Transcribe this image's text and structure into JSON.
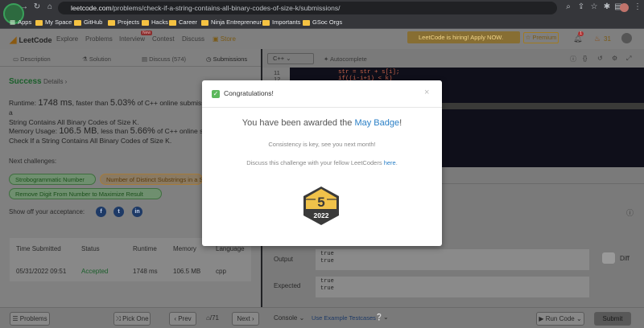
{
  "browser": {
    "url_host": "leetcode.com",
    "url_path": "/problems/check-if-a-string-contains-all-binary-codes-of-size-k/submissions/",
    "bookmarks": [
      "Apps",
      "My Space",
      "GitHub",
      "Projects",
      "Hacks",
      "Career",
      "Ninja Entrepreneur",
      "Importants",
      "GSoc Orgs"
    ]
  },
  "lc_nav": {
    "logo": "LeetCode",
    "items": [
      "Explore",
      "Problems",
      "Interview",
      "Contest",
      "Discuss",
      "Store"
    ],
    "new_badge": "New",
    "banner": "LeetCode is hiring! Apply NOW.",
    "premium": "Premium",
    "notif_count": "1",
    "streak": "31"
  },
  "left_tabs": [
    "Description",
    "Solution",
    "Discuss (574)",
    "Submissions"
  ],
  "result": {
    "status": "Success",
    "details": "Details",
    "runtime_label": "Runtime:",
    "runtime_value": "1748 ms",
    "runtime_mid": ", faster than",
    "runtime_pct": "5.03%",
    "runtime_tail": "of C++ online submissions for Check If a",
    "runtime_line2": "String Contains All Binary Codes of Size K.",
    "memory_label": "Memory Usage:",
    "memory_value": "106.5 MB",
    "memory_mid": ", less than",
    "memory_pct": "5.66%",
    "memory_tail": "of C++ online submissions for",
    "memory_line2": "Check If a String Contains All Binary Codes of Size K."
  },
  "next": {
    "label": "Next challenges:",
    "challenges": [
      "Strobogrammatic Number",
      "Number of Distinct Substrings in a String",
      "Remove Digit From Number to Maximize Result"
    ]
  },
  "share_label": "Show off your acceptance:",
  "table": {
    "headers": [
      "Time Submitted",
      "Status",
      "Runtime",
      "Memory",
      "Language"
    ],
    "row": [
      "05/31/2022 09:51",
      "Accepted",
      "1748 ms",
      "106.5 MB",
      "cpp"
    ]
  },
  "editor": {
    "lang": "C++",
    "autocomplete": "Autocomplete",
    "line_numbers": [
      "11",
      "12"
    ],
    "code_lines": [
      "str = str + s[i];",
      "if((i-i+1) < k)"
    ]
  },
  "console": {
    "output_label": "Output",
    "expected_label": "Expected",
    "output_lines": [
      "true",
      "true"
    ],
    "expected_lines": [
      "true",
      "true"
    ],
    "diff": "Diff"
  },
  "bottom": {
    "problems": "Problems",
    "pick_one": "Pick One",
    "prev": "Prev",
    "page": "/71",
    "next": "Next",
    "console": "Console",
    "use_example": "Use Example Testcases",
    "run_code": "Run Code",
    "submit": "Submit"
  },
  "modal": {
    "title": "Congratulations!",
    "awarded_prefix": "You have been awarded the",
    "badge_name": "May Badge",
    "awarded_suffix": "!",
    "consistency": "Consistency is key, see you next month!",
    "discuss_prefix": "Discuss this challenge with your fellow LeetCoders",
    "discuss_link": "here",
    "discuss_suffix": ".",
    "badge_number": "5",
    "badge_year": "2022"
  },
  "colors": {
    "accent_blue": "#2a7fc6",
    "success_green": "#5cb85c",
    "badge_gold": "#f0c24a",
    "badge_dark": "#3a3a3a"
  }
}
